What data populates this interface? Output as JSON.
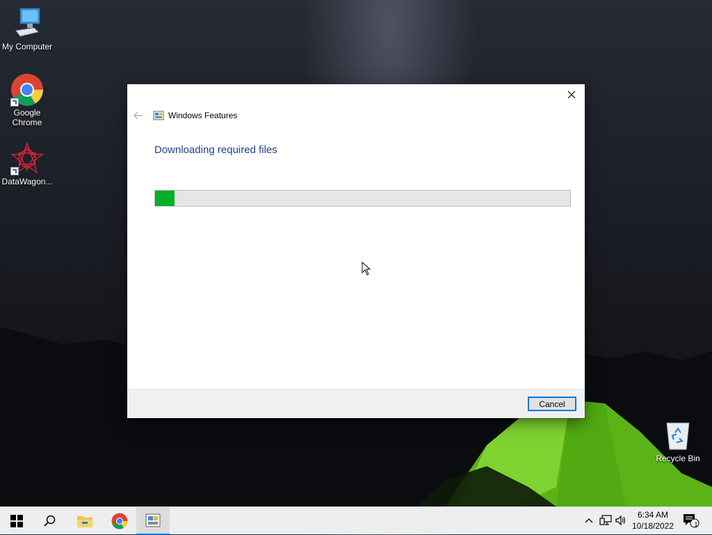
{
  "desktop": {
    "icons": [
      {
        "label": "My Computer"
      },
      {
        "label": "Google Chrome"
      },
      {
        "label": "DataWagon..."
      },
      {
        "label": "Recycle Bin"
      }
    ]
  },
  "dialog": {
    "title": "Windows Features",
    "heading": "Downloading required files",
    "progress_percent": 4.7,
    "cancel_label": "Cancel"
  },
  "taskbar": {
    "time": "6:34 AM",
    "date": "10/18/2022",
    "notification_count": "1"
  },
  "colors": {
    "accent": "#0078d7",
    "progress": "#06b025",
    "heading": "#1e3f8c"
  }
}
